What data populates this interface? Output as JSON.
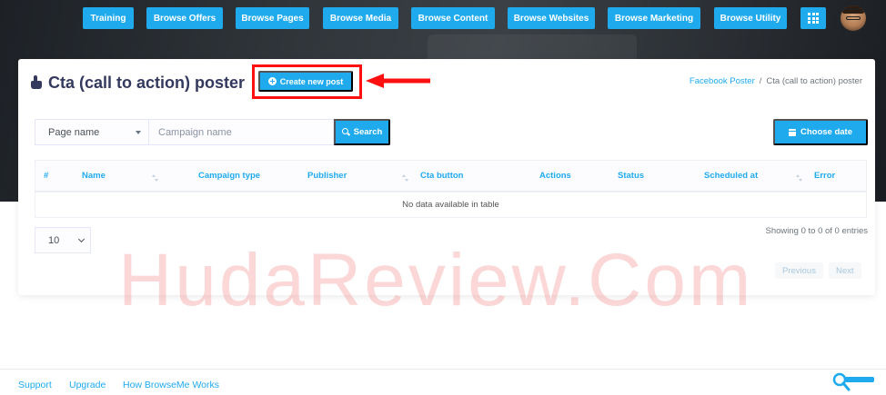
{
  "nav": {
    "items": [
      {
        "label": "Training"
      },
      {
        "label": "Browse Offers"
      },
      {
        "label": "Browse Pages"
      },
      {
        "label": "Browse Media"
      },
      {
        "label": "Browse Content"
      },
      {
        "label": "Browse Websites"
      },
      {
        "label": "Browse Marketing"
      },
      {
        "label": "Browse Utility"
      }
    ],
    "grid_icon": "grid-icon",
    "avatar_icon": "avatar"
  },
  "page": {
    "title": "Cta (call to action) poster",
    "title_icon": "hand-pointer-icon",
    "create_button": "Create new post"
  },
  "breadcrumb": {
    "parent": "Facebook Poster",
    "separator": "/",
    "current": "Cta (call to action) poster"
  },
  "filters": {
    "page_select": "Page name",
    "campaign_placeholder": "Campaign name",
    "search_label": "Search",
    "date_label": "Choose date"
  },
  "table": {
    "columns": [
      "#",
      "Name",
      "Campaign type",
      "Publisher",
      "Cta button",
      "Actions",
      "Status",
      "Scheduled at",
      "Error"
    ],
    "empty_message": "No data available in table"
  },
  "pagination": {
    "length_value": "10",
    "info": "Showing 0 to 0 of 0 entries",
    "previous": "Previous",
    "next": "Next"
  },
  "watermark": "HudaReview.Com",
  "footer": {
    "links": [
      "Support",
      "Upgrade",
      "How BrowseMe Works"
    ]
  },
  "colors": {
    "accent": "#1faaee",
    "highlight_frame": "#ff1010",
    "heading": "#34395e"
  }
}
